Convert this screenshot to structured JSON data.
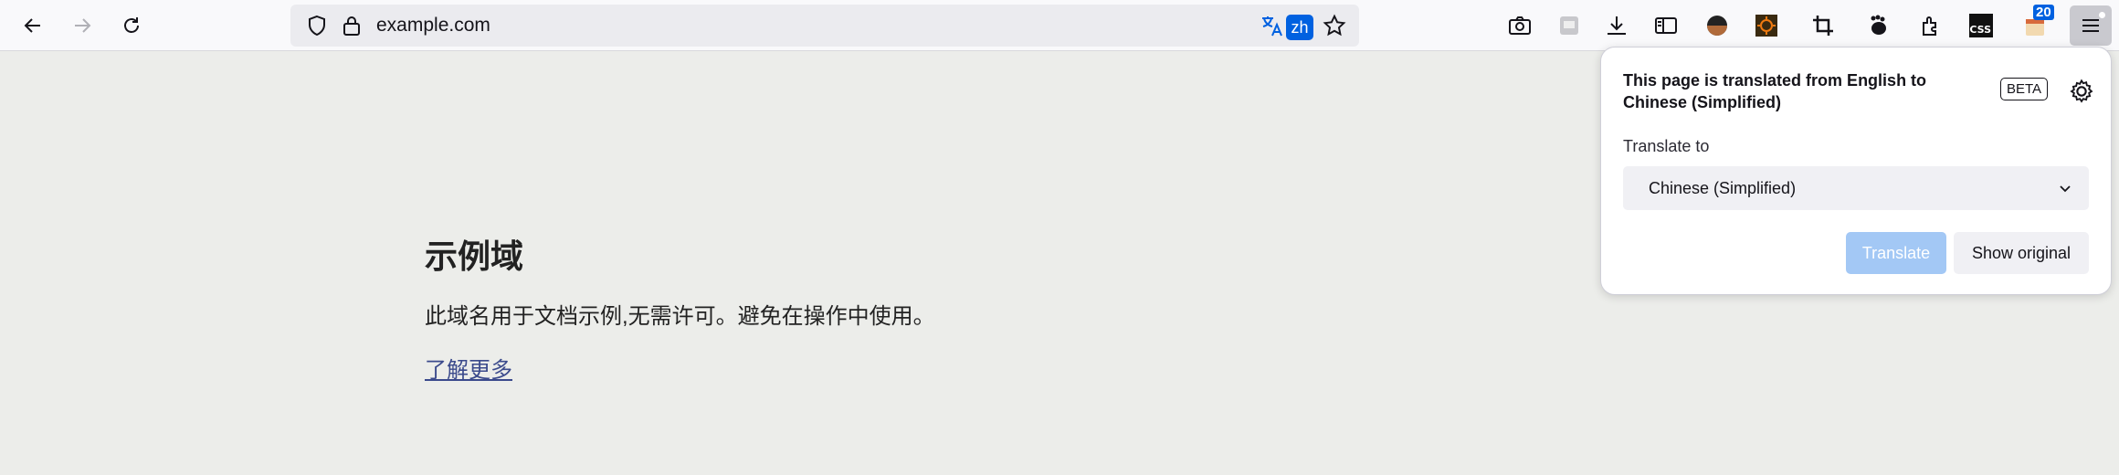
{
  "urlbar": {
    "url": "example.com",
    "lang_badge": "zh"
  },
  "toolbar": {
    "notification_count": "20",
    "css_label": "CSS"
  },
  "page": {
    "heading": "示例域",
    "paragraph": "此域名用于文档示例,无需许可。避免在操作中使用。",
    "link": "了解更多"
  },
  "panel": {
    "title": "This page is translated from English to Chinese (Simplified)",
    "beta": "BETA",
    "translate_to_label": "Translate to",
    "selected_language": "Chinese (Simplified)",
    "translate_button": "Translate",
    "show_original_button": "Show original"
  },
  "colors": {
    "accent": "#0061e0",
    "translate_disabled": "#a3c8f5",
    "page_bg": "#ecedea"
  }
}
